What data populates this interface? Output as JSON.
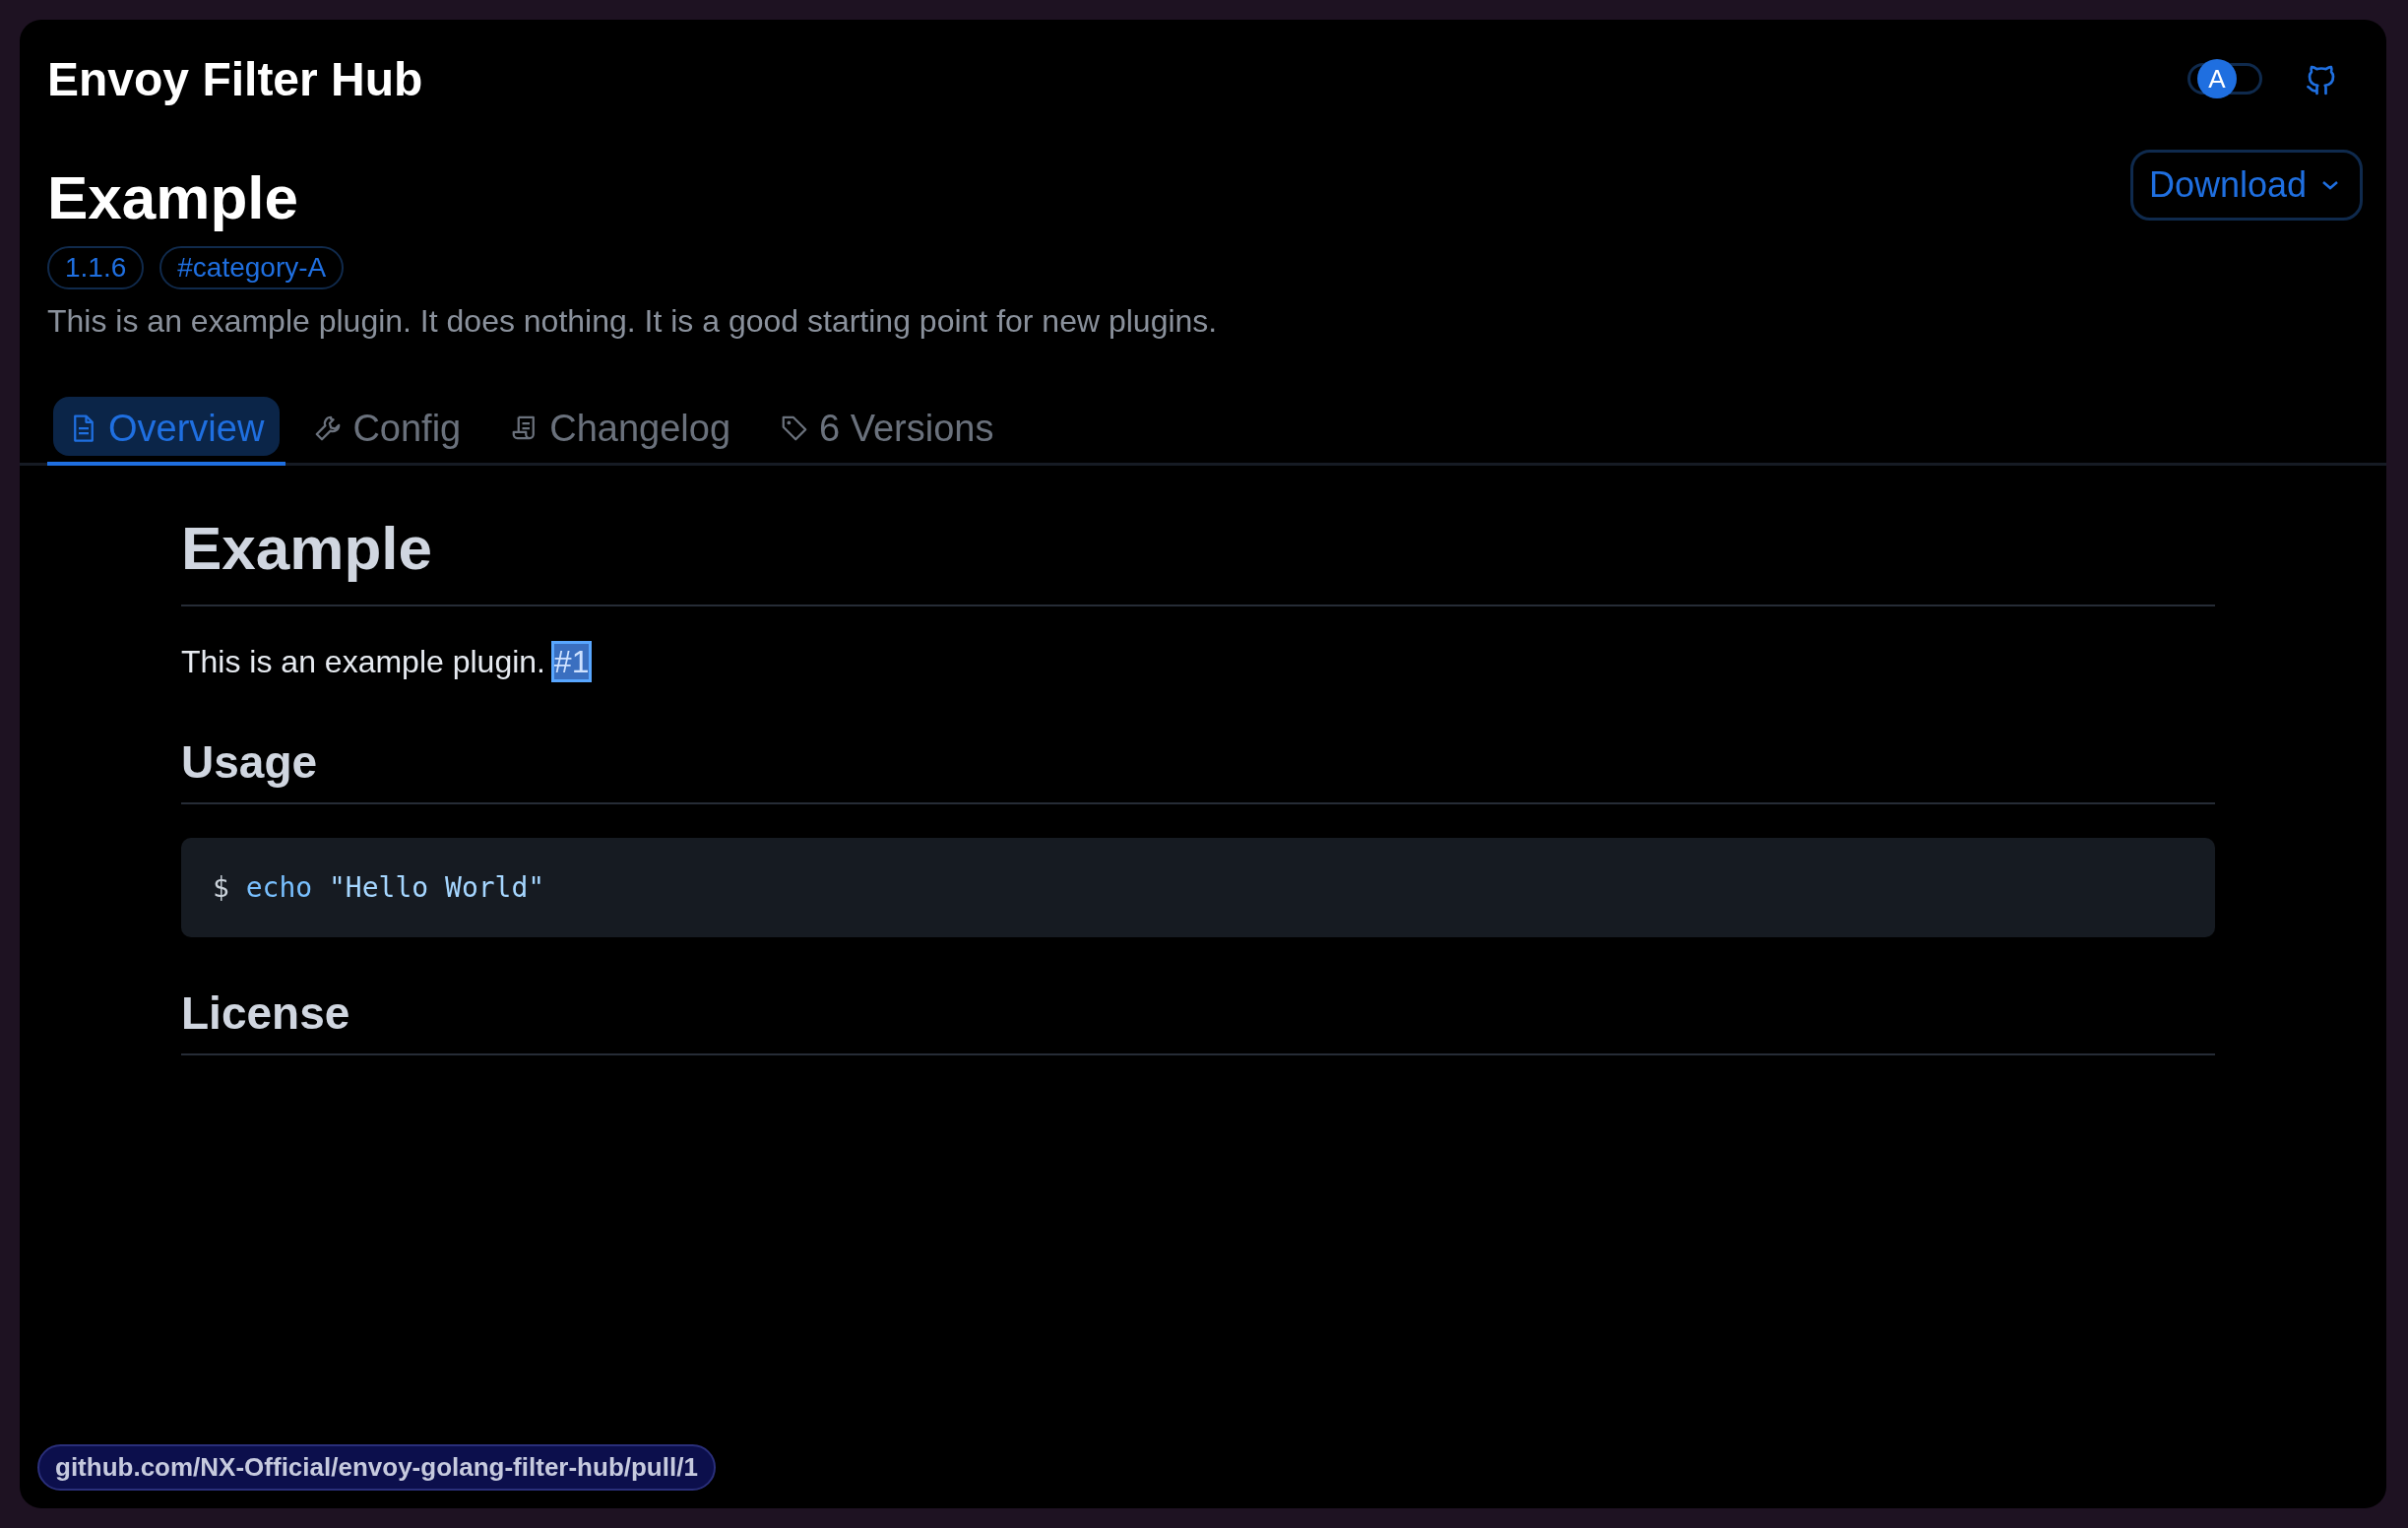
{
  "header": {
    "title": "Envoy Filter Hub",
    "theme_toggle": {
      "label": "A",
      "on": false
    }
  },
  "plugin": {
    "name": "Example",
    "tags": [
      "1.1.6",
      "#category-A"
    ],
    "description": "This is an example plugin. It does nothing. It is a good starting point for new plugins.",
    "download_button": "Download"
  },
  "tabs": [
    {
      "label": "Overview",
      "kind": "doc",
      "selected": true
    },
    {
      "label": "Config",
      "kind": "wrench",
      "selected": false
    },
    {
      "label": "Changelog",
      "kind": "scroll",
      "selected": false
    },
    {
      "label": "6 Versions",
      "kind": "tag",
      "selected": false
    }
  ],
  "readme": [
    {
      "kind": "h1",
      "text": "Example"
    },
    {
      "kind": "p",
      "text": "This is an example plugin.",
      "link": {
        "text": "#1",
        "focused": true
      }
    },
    {
      "kind": "h2",
      "text": "Usage"
    },
    {
      "kind": "code",
      "prompt": "$",
      "command": "echo",
      "argument": "\"Hello World\""
    },
    {
      "kind": "h2",
      "text": "License"
    }
  ],
  "status_url": "github.com/NX-Official/envoy-golang-filter-hub/pull/1"
}
